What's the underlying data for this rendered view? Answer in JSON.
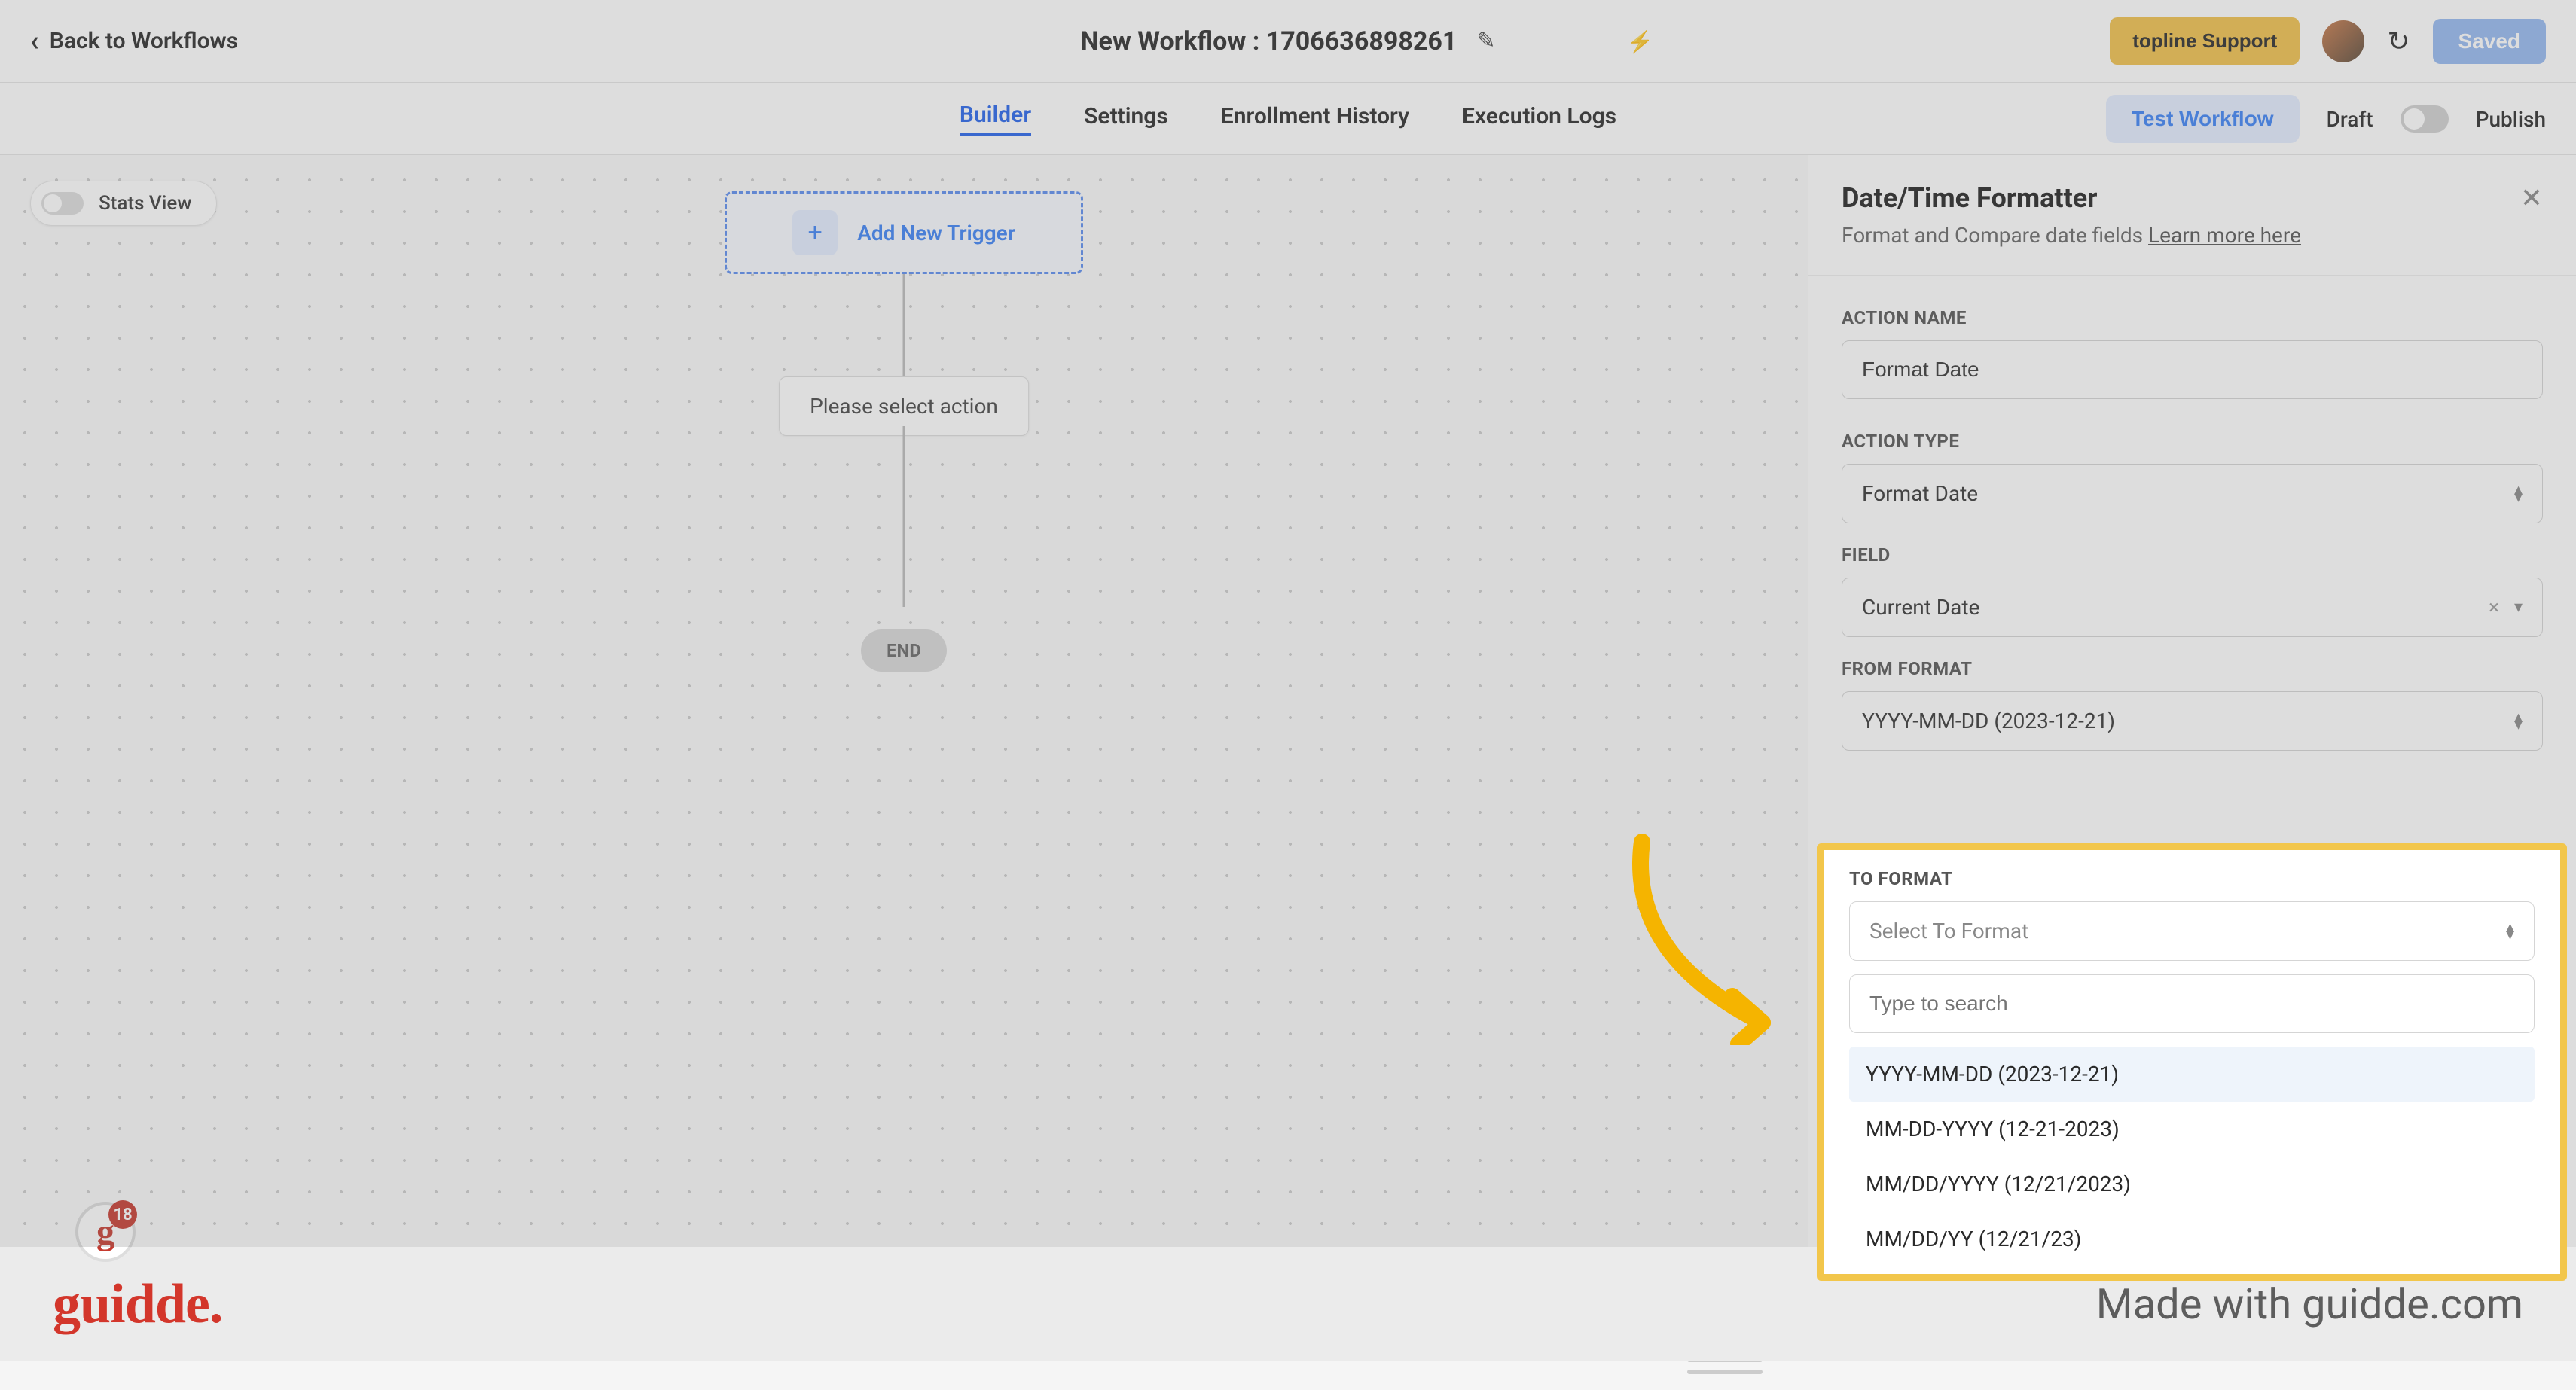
{
  "topbar": {
    "back_label": "Back to Workflows",
    "title": "New Workflow : 1706636898261",
    "support_label": "topline Support",
    "saved_label": "Saved"
  },
  "tabs": {
    "builder": "Builder",
    "settings": "Settings",
    "enrollment": "Enrollment History",
    "execution": "Execution Logs",
    "test_workflow": "Test Workflow",
    "draft": "Draft",
    "publish": "Publish"
  },
  "canvas": {
    "stats_view": "Stats View",
    "add_trigger": "Add New Trigger",
    "select_action": "Please select action",
    "end": "END",
    "badge_count": "18"
  },
  "panel": {
    "title": "Date/Time Formatter",
    "subtitle": "Format and Compare date fields ",
    "learn_more": "Learn more here",
    "action_name_label": "ACTION NAME",
    "action_name_value": "Format Date",
    "action_type_label": "ACTION TYPE",
    "action_type_value": "Format Date",
    "field_label": "FIELD",
    "field_value": "Current Date",
    "from_format_label": "FROM FORMAT",
    "from_format_value": "YYYY-MM-DD (2023-12-21)",
    "to_format_label": "TO FORMAT",
    "to_format_placeholder": "Select To Format",
    "search_placeholder": "Type to search",
    "options": [
      "YYYY-MM-DD (2023-12-21)",
      "MM-DD-YYYY (12-21-2023)",
      "MM/DD/YYYY (12/21/2023)",
      "MM/DD/YY (12/21/23)"
    ]
  },
  "footer": {
    "logo": "guidde.",
    "made_with": "Made with guidde.com"
  }
}
